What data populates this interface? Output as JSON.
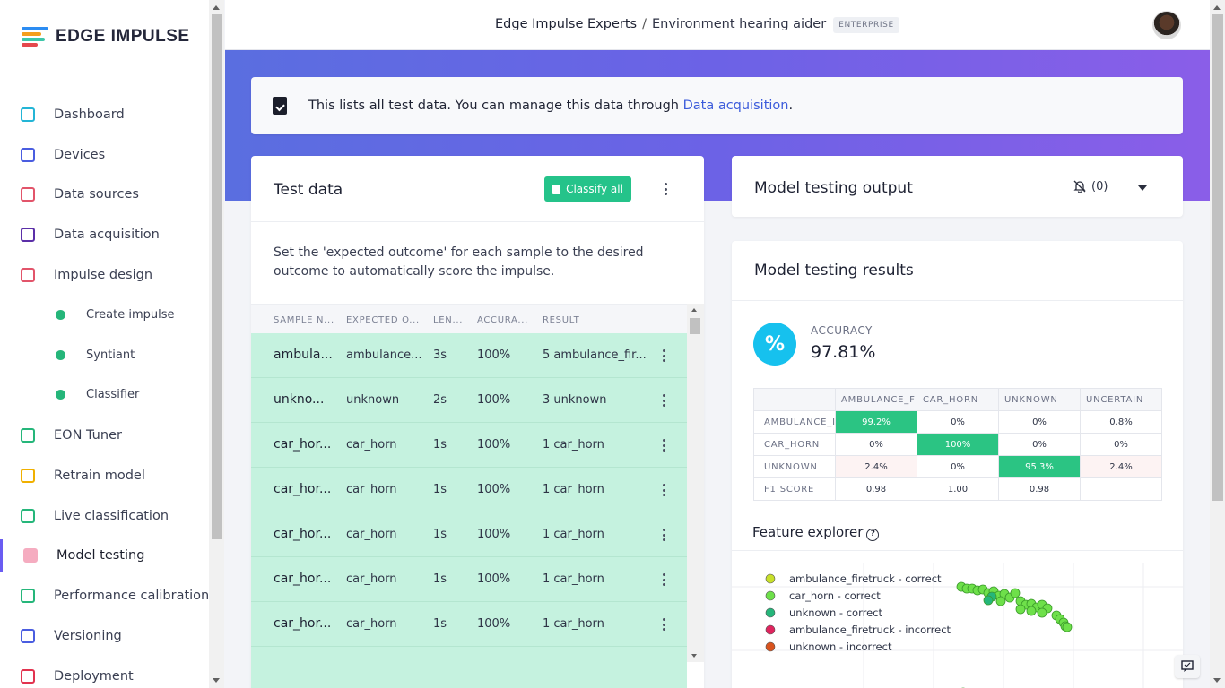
{
  "brand": {
    "name": "EDGE IMPULSE",
    "bar_colors": [
      "#2c8cf2",
      "#f59e1c",
      "#3ec6a8",
      "#e5484d"
    ]
  },
  "sidebar": {
    "items": [
      {
        "label": "Dashboard",
        "icon": "monitor-icon",
        "color": "#23b5d6"
      },
      {
        "label": "Devices",
        "icon": "chip-icon",
        "color": "#4a5de0"
      },
      {
        "label": "Data sources",
        "icon": "magic-wand-icon",
        "color": "#e2546a"
      },
      {
        "label": "Data acquisition",
        "icon": "database-icon",
        "color": "#5b2fa8"
      },
      {
        "label": "Impulse design",
        "icon": "pulse-icon",
        "color": "#e2546a"
      },
      {
        "label": "Create impulse",
        "icon": "dot-icon",
        "sub": true
      },
      {
        "label": "Syntiant",
        "icon": "dot-icon",
        "sub": true
      },
      {
        "label": "Classifier",
        "icon": "dot-icon",
        "sub": true
      },
      {
        "label": "EON Tuner",
        "icon": "compass-icon",
        "color": "#25b67a"
      },
      {
        "label": "Retrain model",
        "icon": "shuffle-icon",
        "color": "#f0b000"
      },
      {
        "label": "Live classification",
        "icon": "antenna-icon",
        "color": "#25b67a"
      },
      {
        "label": "Model testing",
        "icon": "clipboard-icon",
        "color": "#f28aa6",
        "active": true
      },
      {
        "label": "Performance calibration",
        "icon": "chart-icon",
        "color": "#25b67a"
      },
      {
        "label": "Versioning",
        "icon": "branch-icon",
        "color": "#4a5de0"
      },
      {
        "label": "Deployment",
        "icon": "box-icon",
        "color": "#e2334f"
      }
    ]
  },
  "header": {
    "org": "Edge Impulse Experts",
    "separator": "/",
    "project": "Environment hearing aider",
    "badge": "ENTERPRISE"
  },
  "info": {
    "text": "This lists all test data. You can manage this data through ",
    "link": "Data acquisition",
    "suffix": "."
  },
  "test_data": {
    "title": "Test data",
    "classify_all": "Classify all",
    "description": "Set the 'expected outcome' for each sample to the desired outcome to automatically score the impulse.",
    "columns": [
      "SAMPLE N...",
      "EXPECTED O...",
      "LEN...",
      "ACCURA...",
      "RESULT"
    ],
    "rows": [
      {
        "name": "ambula...",
        "expected": "ambulance...",
        "length": "3s",
        "accuracy": "100%",
        "result": "5 ambulance_fir..."
      },
      {
        "name": "unkno...",
        "expected": "unknown",
        "length": "2s",
        "accuracy": "100%",
        "result": "3 unknown"
      },
      {
        "name": "car_hor...",
        "expected": "car_horn",
        "length": "1s",
        "accuracy": "100%",
        "result": "1 car_horn"
      },
      {
        "name": "car_hor...",
        "expected": "car_horn",
        "length": "1s",
        "accuracy": "100%",
        "result": "1 car_horn"
      },
      {
        "name": "car_hor...",
        "expected": "car_horn",
        "length": "1s",
        "accuracy": "100%",
        "result": "1 car_horn"
      },
      {
        "name": "car_hor...",
        "expected": "car_horn",
        "length": "1s",
        "accuracy": "100%",
        "result": "1 car_horn"
      },
      {
        "name": "car_hor...",
        "expected": "car_horn",
        "length": "1s",
        "accuracy": "100%",
        "result": "1 car_horn"
      },
      {
        "name": "",
        "expected": "",
        "length": "",
        "accuracy": "",
        "result": ""
      }
    ]
  },
  "output": {
    "title": "Model testing output",
    "count": "(0)"
  },
  "results": {
    "title": "Model testing results",
    "accuracy_label": "ACCURACY",
    "accuracy_value": "97.81%",
    "accuracy_icon": "%",
    "matrix": {
      "columns": [
        "AMBULANCE_F",
        "CAR_HORN",
        "UNKNOWN",
        "UNCERTAIN"
      ],
      "rows": [
        {
          "label": "AMBULANCE_I",
          "cells": [
            "99.2%",
            "0%",
            "0%",
            "0.8%"
          ],
          "styles": [
            "hi",
            "",
            "",
            ""
          ]
        },
        {
          "label": "CAR_HORN",
          "cells": [
            "0%",
            "100%",
            "0%",
            "0%"
          ],
          "styles": [
            "",
            "hi",
            "",
            ""
          ]
        },
        {
          "label": "UNKNOWN",
          "cells": [
            "2.4%",
            "0%",
            "95.3%",
            "2.4%"
          ],
          "styles": [
            "lo",
            "",
            "hi",
            "lo"
          ]
        },
        {
          "label": "F1 SCORE",
          "cells": [
            "0.98",
            "1.00",
            "0.98",
            ""
          ],
          "styles": [
            "",
            "",
            "",
            ""
          ]
        }
      ]
    },
    "feature_explorer": {
      "title": "Feature explorer",
      "help_icon": "?",
      "legend": [
        {
          "label": "ambulance_firetruck - correct",
          "color": "#c8e02a"
        },
        {
          "label": "car_horn - correct",
          "color": "#6ee04a"
        },
        {
          "label": "unknown - correct",
          "color": "#25b67a"
        },
        {
          "label": "ambulance_firetruck - incorrect",
          "color": "#e0245e"
        },
        {
          "label": "unknown - incorrect",
          "color": "#d9531e"
        }
      ]
    }
  }
}
